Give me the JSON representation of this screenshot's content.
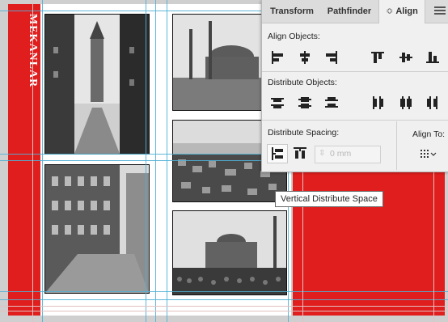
{
  "document": {
    "vertical_title": "MEKANLAR",
    "photos": [
      "galata-tower-street-photo",
      "hagia-sophia-photo",
      "istanbul-panorama-photo",
      "old-street-buildings-photo",
      "mosque-crowd-photo"
    ]
  },
  "align_panel": {
    "tabs": [
      "Transform",
      "Pathfinder",
      "Align"
    ],
    "active_tab_marker": "≎",
    "align_objects_label": "Align Objects:",
    "distribute_objects_label": "Distribute Objects:",
    "distribute_spacing_label": "Distribute Spacing:",
    "align_to_label": "Align To:",
    "spacing_value": "0 mm",
    "tooltip": "Vertical Distribute Space"
  }
}
